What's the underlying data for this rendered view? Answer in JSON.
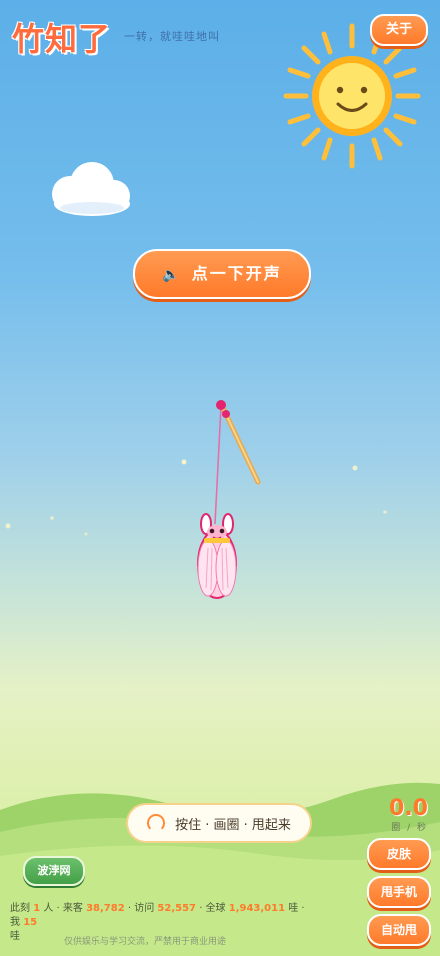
{
  "header": {
    "logo": "竹知了",
    "tagline": "一转，就哇哇地叫",
    "about_label": "关于"
  },
  "sound_button": {
    "icon": "speaker-icon",
    "label": "点一下开声"
  },
  "hint": {
    "icon": "rotate-icon",
    "text": "按住 · 画圈 · 甩起来"
  },
  "left_button": {
    "label": "波浡网"
  },
  "rate": {
    "value": "0.0",
    "unit": "圈 / 秒"
  },
  "side_buttons": [
    {
      "label": "皮肤"
    },
    {
      "label": "甩手机"
    },
    {
      "label": "自动甩"
    }
  ],
  "stats": {
    "now_label": "此刻",
    "now_value": "1",
    "now_unit": "人 · 来客",
    "visitors_value": "38,782",
    "visits_label": "· 访问",
    "visits_value": "52,557",
    "global_label": "· 全球",
    "global_value": "1,943,011",
    "wa_label": "哇 · 我",
    "mine_value": "15",
    "mine_unit": "哇"
  },
  "disclaimer": "仅供娱乐与学习交流，严禁用于商业用途",
  "colors": {
    "accent": "#ff7a2a",
    "sky_top": "#5cafe8",
    "grass": "#9ed36a",
    "sun": "#ffd24a"
  }
}
